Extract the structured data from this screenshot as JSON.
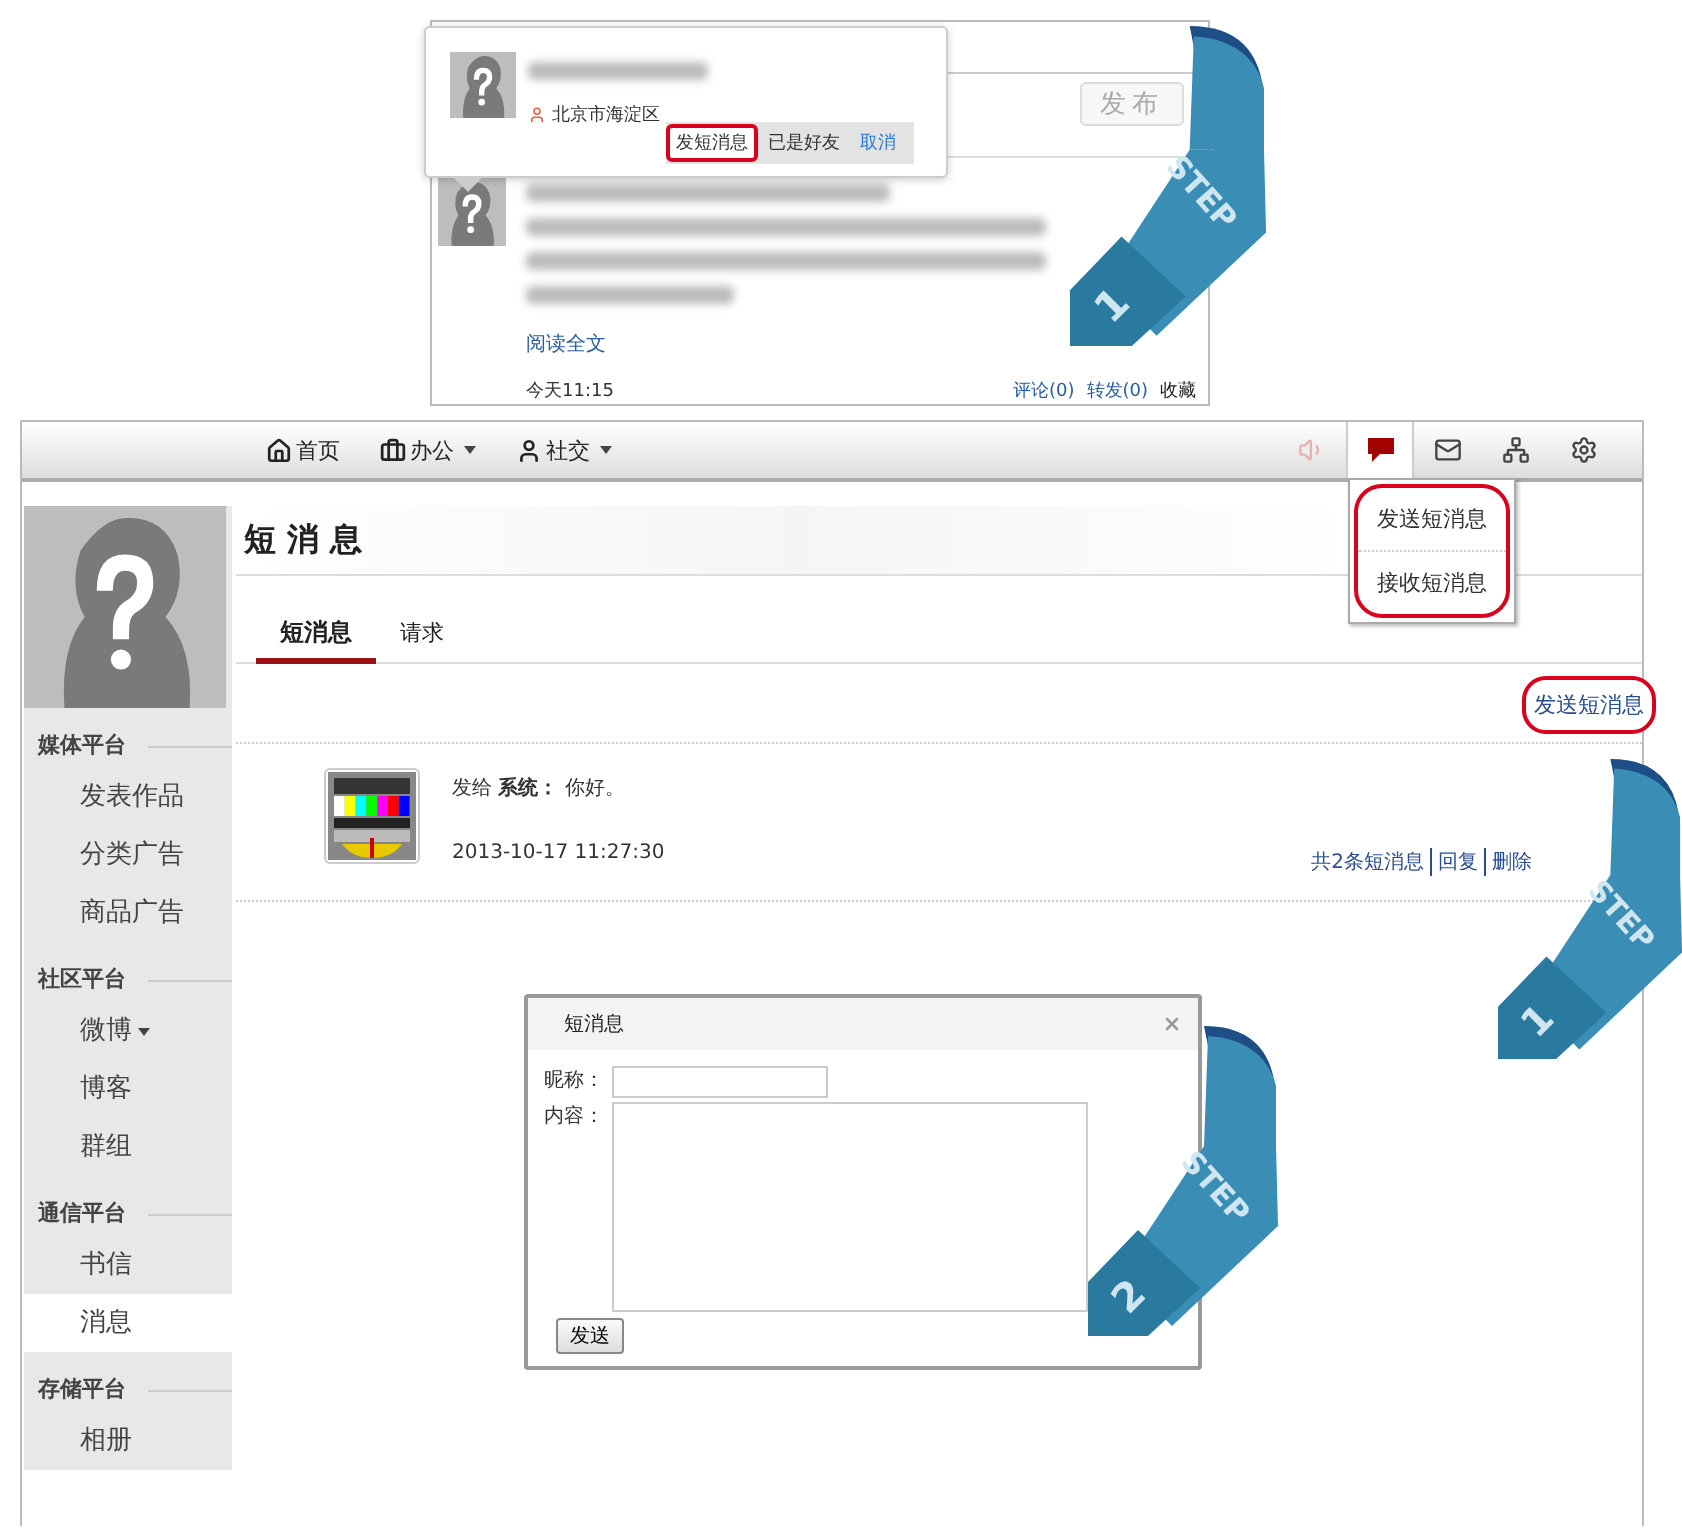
{
  "weibo_snippet": {
    "location": "北京市海淀区",
    "actions": [
      {
        "label": "发短消息",
        "highlighted": true,
        "kind": "plain"
      },
      {
        "label": "已是好友",
        "highlighted": false,
        "kind": "plain"
      },
      {
        "label": "取消",
        "highlighted": false,
        "kind": "link"
      }
    ],
    "publish_button": "发布",
    "read_more": "阅读全文",
    "time": "今天11:15",
    "links": [
      {
        "label": "评论(0)",
        "kind": "link"
      },
      {
        "label": "转发(0)",
        "kind": "link"
      },
      {
        "label": "收藏",
        "kind": "plain"
      }
    ],
    "ribbon": {
      "label": "STEP",
      "number": "1"
    }
  },
  "nav": {
    "items": [
      {
        "label": "首页",
        "dropdown": false
      },
      {
        "label": "办公",
        "dropdown": true
      },
      {
        "label": "社交",
        "dropdown": true
      }
    ],
    "icons": [
      {
        "kind": "sound",
        "selected": false
      },
      {
        "kind": "chat",
        "selected": true
      },
      {
        "kind": "mail",
        "selected": false
      },
      {
        "kind": "network",
        "selected": false
      },
      {
        "kind": "settings",
        "selected": false
      }
    ],
    "menu": {
      "highlighted": true,
      "items": [
        "发送短消息",
        "接收短消息"
      ]
    }
  },
  "sidebar": {
    "sections": [
      {
        "title": "媒体平台",
        "items": [
          {
            "label": "发表作品",
            "dropdown": false,
            "selected": false
          },
          {
            "label": "分类广告",
            "dropdown": false,
            "selected": false
          },
          {
            "label": "商品广告",
            "dropdown": false,
            "selected": false
          }
        ]
      },
      {
        "title": "社区平台",
        "items": [
          {
            "label": "微博",
            "dropdown": true,
            "selected": false
          },
          {
            "label": "博客",
            "dropdown": false,
            "selected": false
          },
          {
            "label": "群组",
            "dropdown": false,
            "selected": false
          }
        ]
      },
      {
        "title": "通信平台",
        "items": [
          {
            "label": "书信",
            "dropdown": false,
            "selected": false
          },
          {
            "label": "消息",
            "dropdown": false,
            "selected": true
          }
        ]
      },
      {
        "title": "存储平台",
        "items": [
          {
            "label": "相册",
            "dropdown": false,
            "selected": false
          }
        ]
      }
    ]
  },
  "page": {
    "title": "短 消 息",
    "tabs": [
      {
        "label": "短消息",
        "selected": true
      },
      {
        "label": "请求",
        "selected": false
      }
    ],
    "send_link": {
      "label": "发送短消息",
      "highlighted": true
    },
    "messages": [
      {
        "line": "发给 **系统：** 你好。",
        "time": "2013-10-17 11:27:30"
      }
    ],
    "footer_links": [
      "共2条短消息",
      "回复",
      "删除"
    ],
    "ribbon": {
      "label": "STEP",
      "number": "1"
    }
  },
  "dialog": {
    "title": "短消息",
    "fields": [
      {
        "kind": "input",
        "label": "昵称："
      },
      {
        "kind": "textarea",
        "label": "内容："
      }
    ],
    "button": "发送",
    "ribbon": {
      "label": "STEP",
      "number": "2"
    }
  }
}
